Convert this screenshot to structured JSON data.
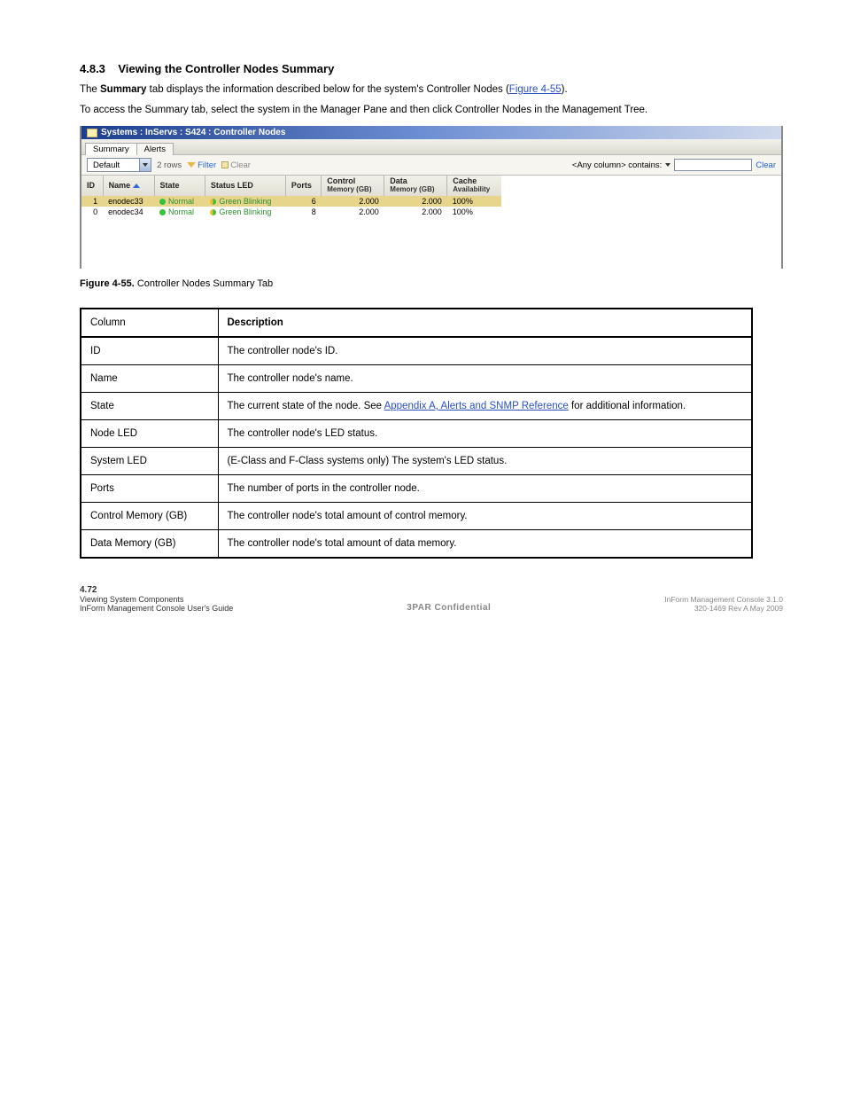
{
  "section": {
    "number": "4.8.3",
    "title": "Viewing the Controller Nodes Summary"
  },
  "paragraphs": {
    "p1_a": "The ",
    "p1_b": "Summary",
    "p1_c": " tab displays the information described below for the system's Controller Nodes (",
    "p1_link": "Figure 4-55",
    "p1_d": ").",
    "p2": "To access the Summary tab, select the system in the Manager Pane and then click Controller Nodes in the Management Tree."
  },
  "figure": {
    "titlebar": "Systems : InServs : S424 : Controller Nodes",
    "tabs": {
      "active": "Summary",
      "other": "Alerts"
    },
    "toolbar": {
      "combo": "Default",
      "rows": "2 rows",
      "filter": "Filter",
      "clear": "Clear",
      "right_label": "<Any column> contains:",
      "clear_right": "Clear"
    },
    "columns": {
      "id": "ID",
      "name": "Name",
      "state": "State",
      "led": "Status LED",
      "ports": "Ports",
      "control_a": "Control",
      "control_b": "Memory (GB)",
      "data_a": "Data",
      "data_b": "Memory (GB)",
      "cache_a": "Cache",
      "cache_b": "Availability"
    },
    "rows": [
      {
        "id": "1",
        "name": "enodec33",
        "state": "Normal",
        "led": "Green Blinking",
        "ports": "6",
        "control": "2.000",
        "data": "2.000",
        "cache": "100%"
      },
      {
        "id": "0",
        "name": "enodec34",
        "state": "Normal",
        "led": "Green Blinking",
        "ports": "8",
        "control": "2.000",
        "data": "2.000",
        "cache": "100%"
      }
    ],
    "caption_a": "Figure 4-55.",
    "caption_b": "Controller Nodes Summary Tab"
  },
  "table": {
    "head_a": "Column",
    "head_b": "Description",
    "rows": [
      {
        "a": "ID",
        "b": "The controller node's ID."
      },
      {
        "a": "Name",
        "b": "The controller node's name."
      },
      {
        "a": "State",
        "link_before": "The current state of the node. See ",
        "link": "Appendix A, Alerts and SNMP Reference",
        "link_after": " for additional information."
      },
      {
        "a": "Node LED",
        "b": "The controller node's LED status."
      },
      {
        "a": "System LED",
        "b": "(E-Class and F-Class systems only) The system's LED status."
      },
      {
        "a": "Ports",
        "b": "The number of ports in the controller node."
      },
      {
        "a": "Control Memory (GB)",
        "b": "The controller node's total amount of control memory."
      },
      {
        "a": "Data Memory (GB)",
        "b": "The controller node's total amount of data memory."
      }
    ]
  },
  "footer": {
    "page": "4.72",
    "left_a": "Viewing System Components",
    "left_b": "InForm Management Console User's Guide",
    "confid": "3PAR Confidential",
    "right_a": "InForm Management Console 3.1.0",
    "right_b": "320-1469 Rev A May 2009"
  }
}
